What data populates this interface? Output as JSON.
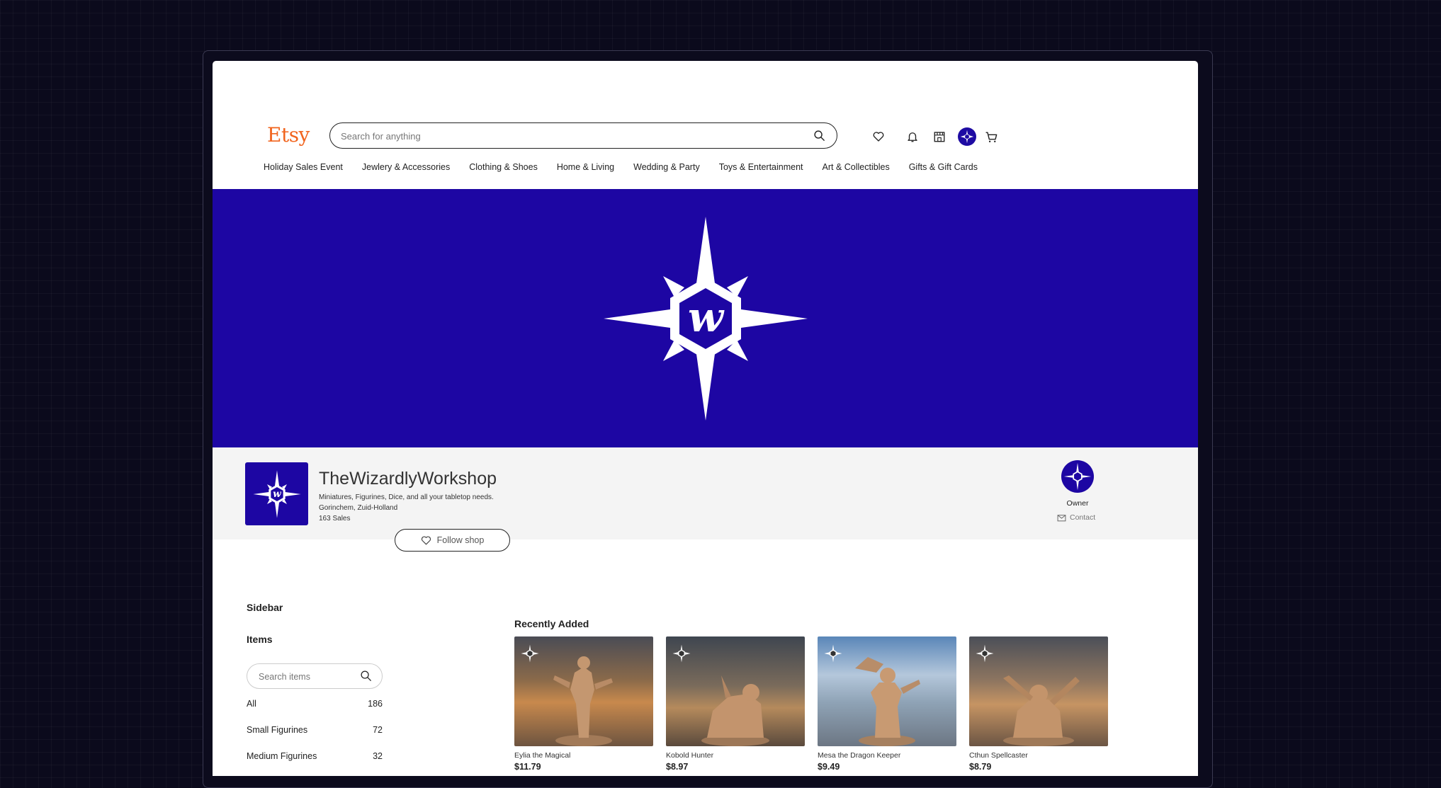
{
  "header": {
    "logo": "Etsy",
    "search_placeholder": "Search for anything",
    "icons": [
      "heart-icon",
      "bell-icon",
      "shop-icon",
      "user-avatar",
      "cart-icon"
    ]
  },
  "nav": {
    "items": [
      "Holiday Sales Event",
      "Jewlery & Accessories",
      "Clothing & Shoes",
      "Home & Living",
      "Wedding & Party",
      "Toys & Entertainment",
      "Art & Collectibles",
      "Gifts & Gift Cards"
    ]
  },
  "colors": {
    "brand": "#f1641e",
    "banner": "#1d06a3"
  },
  "shop": {
    "name": "TheWizardlyWorkshop",
    "tagline": "Miniatures, Figurines, Dice, and all your tabletop needs.",
    "location": "Gorinchem, Zuid-Holland",
    "sales": "163 Sales",
    "follow_label": "Follow shop",
    "owner_label": "Owner",
    "contact_label": "Contact"
  },
  "sidebar": {
    "title": "Sidebar",
    "items_title": "Items",
    "search_placeholder": "Search items",
    "categories": [
      {
        "label": "All",
        "count": "186"
      },
      {
        "label": "Small Figurines",
        "count": "72"
      },
      {
        "label": "Medium Figurines",
        "count": "32"
      }
    ]
  },
  "recent": {
    "title": "Recently Added",
    "products": [
      {
        "name": "Eylia the Magical",
        "price": "$11.79"
      },
      {
        "name": "Kobold Hunter",
        "price": "$8.97"
      },
      {
        "name": "Mesa the Dragon Keeper",
        "price": "$9.49"
      },
      {
        "name": "Cthun Spellcaster",
        "price": "$8.79"
      }
    ]
  }
}
